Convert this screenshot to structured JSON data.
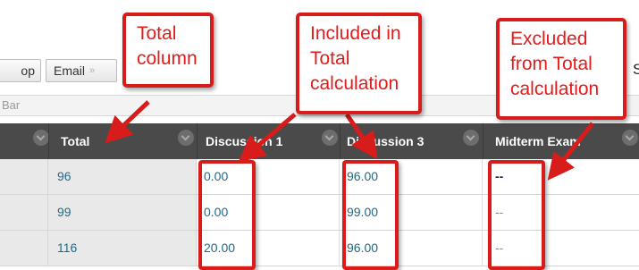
{
  "toolbar": {
    "partial_button_label": "op",
    "email_button_label": "Email",
    "trailing_text": "S"
  },
  "subbar": {
    "text": "Bar"
  },
  "columns": [
    {
      "key": "total",
      "label": "Total"
    },
    {
      "key": "d1",
      "label": "Discussion 1"
    },
    {
      "key": "d3",
      "label": "Discussion 3"
    },
    {
      "key": "midterm",
      "label": "Midterm Exam"
    }
  ],
  "rows": [
    {
      "total": "96",
      "d1": "0.00",
      "d3": "96.00",
      "midterm": "--"
    },
    {
      "total": "99",
      "d1": "0.00",
      "d3": "99.00",
      "midterm": "--"
    },
    {
      "total": "116",
      "d1": "20.00",
      "d3": "96.00",
      "midterm": "--"
    }
  ],
  "annotations": {
    "total_column": [
      "Total",
      "column"
    ],
    "included": [
      "Included in",
      "Total",
      "calculation"
    ],
    "excluded": [
      "Excluded",
      "from Total",
      "calculation"
    ],
    "color": "#d81b1b"
  },
  "colors": {
    "header_bg": "#4a4a4a",
    "link_text": "#1f6a8a",
    "total_column_bg": "#e9e9e9"
  }
}
